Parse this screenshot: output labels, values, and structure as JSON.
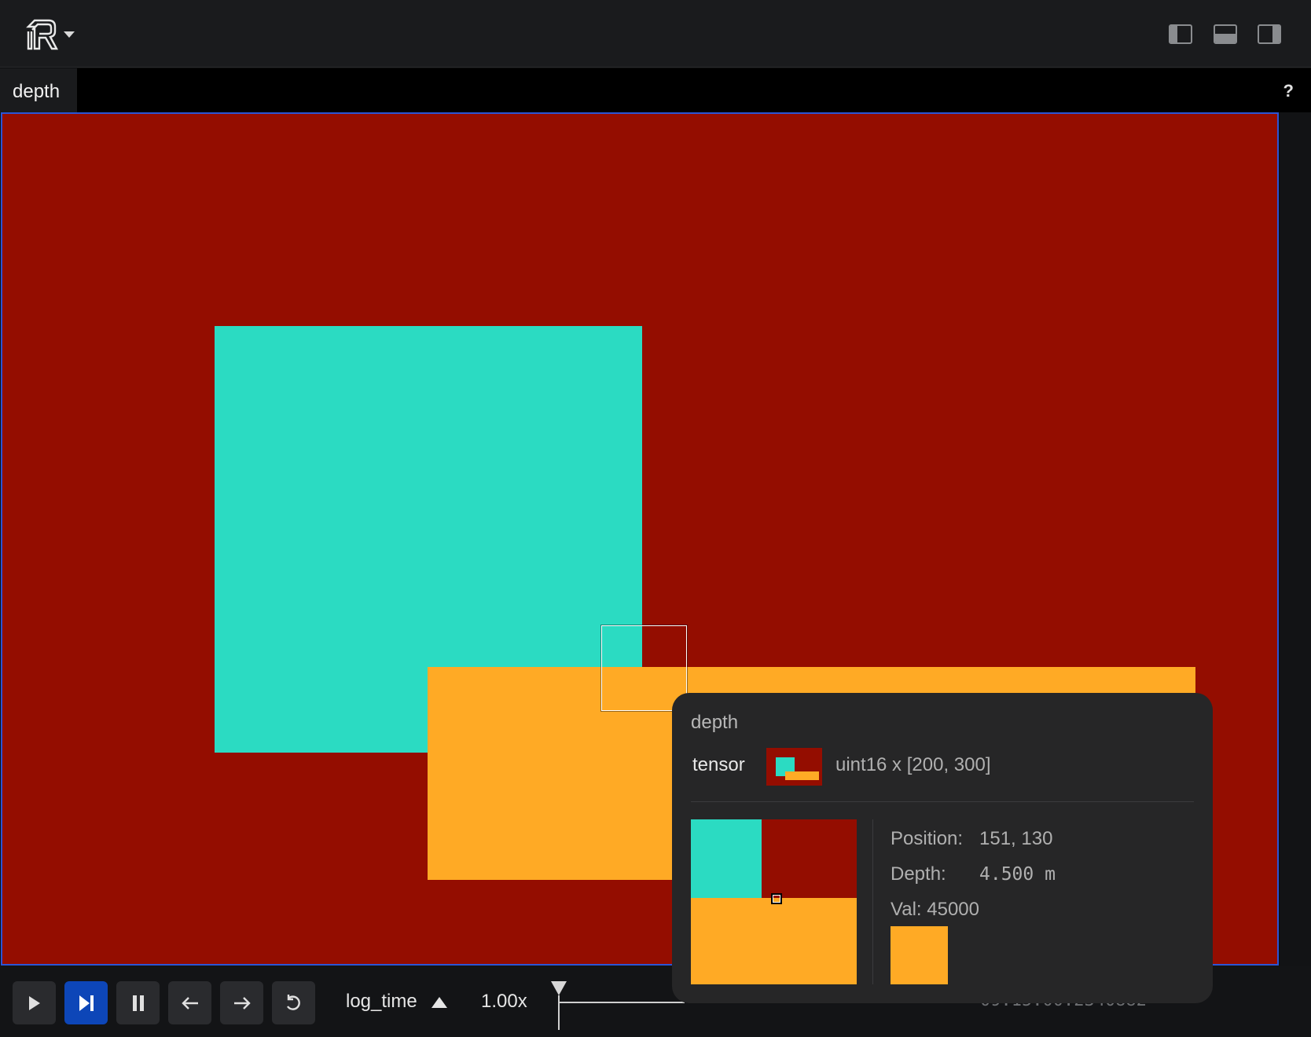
{
  "top_bar": {
    "logo_icon": "rerun-logo-icon",
    "menu_caret_icon": "chevron-down-icon",
    "panel_toggles": [
      "left-panel-toggle-icon",
      "bottom-panel-toggle-icon",
      "right-panel-toggle-icon"
    ]
  },
  "tab_bar": {
    "tabs": [
      {
        "label": "depth"
      }
    ],
    "help_label": "?"
  },
  "viewport": {
    "background_color": "#940d00",
    "regions": [
      {
        "name": "cyan-square",
        "color": "#2bdbc2"
      },
      {
        "name": "orange-rectangle",
        "color": "#ffaa25"
      }
    ],
    "border_color": "#2b55d6"
  },
  "timeline": {
    "buttons": [
      "play-icon",
      "step-forward-icon",
      "pause-icon",
      "arrow-left-icon",
      "arrow-right-icon",
      "loop-icon"
    ],
    "timeline_name": "log_time",
    "speed": "1.00x",
    "time_readout": "09:15:00.2340882"
  },
  "hover_tooltip": {
    "title": "depth",
    "component_key": "tensor",
    "tensor_desc": "uint16 x [200, 300]",
    "position_label": "Position:",
    "position_value": "151, 130",
    "depth_label": "Depth:",
    "depth_value": "4.500 m",
    "val_text": "Val: 45000",
    "swatch_color": "#ffaa25"
  },
  "colors": {
    "accent_blue": "#0d46b8",
    "cyan": "#2bdbc2",
    "orange": "#ffaa25",
    "dark_red": "#940d00"
  }
}
